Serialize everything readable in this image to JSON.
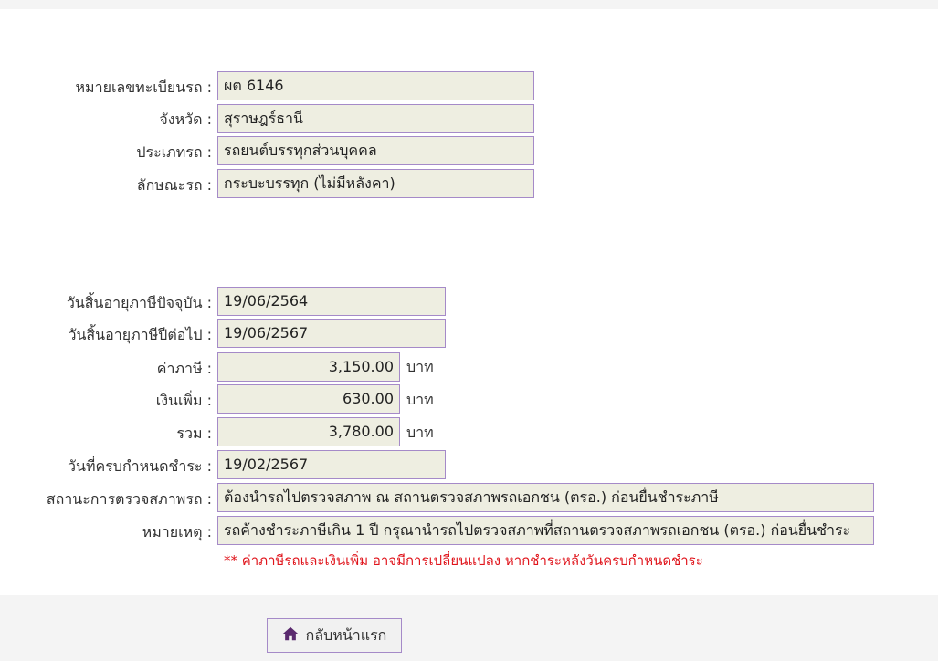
{
  "vehicle": {
    "plate_label": "หมายเลขทะเบียนรถ :",
    "plate_value": "ผต 6146",
    "province_label": "จังหวัด :",
    "province_value": "สุราษฎร์ธานี",
    "type_label": "ประเภทรถ :",
    "type_value": "รถยนต์บรรทุกส่วนบุคคล",
    "body_label": "ลักษณะรถ :",
    "body_value": "กระบะบรรทุก (ไม่มีหลังคา)"
  },
  "tax": {
    "current_expiry_label": "วันสิ้นอายุภาษีปัจจุบัน :",
    "current_expiry_value": "19/06/2564",
    "next_expiry_label": "วันสิ้นอายุภาษีปีต่อไป :",
    "next_expiry_value": "19/06/2567",
    "fee_label": "ค่าภาษี :",
    "fee_value": "3,150.00",
    "surcharge_label": "เงินเพิ่ม :",
    "surcharge_value": "630.00",
    "total_label": "รวม :",
    "total_value": "3,780.00",
    "unit": "บาท",
    "due_label": "วันที่ครบกำหนดชำระ :",
    "due_value": "19/02/2567",
    "inspection_label": "สถานะการตรวจสภาพรถ :",
    "inspection_value": "ต้องนำรถไปตรวจสภาพ ณ สถานตรวจสภาพรถเอกชน (ตรอ.) ก่อนยื่นชำระภาษี",
    "remark_label": "หมายเหตุ :",
    "remark_value": "รถค้างชำระภาษีเกิน 1 ปี กรุณานำรถไปตรวจสภาพที่สถานตรวจสภาพรถเอกชน (ตรอ.) ก่อนยื่นชำระ",
    "warning_note": "** ค่าภาษีรถและเงินเพิ่ม อาจมีการเปลี่ยนแปลง หากชำระหลังวันครบกำหนดชำระ"
  },
  "actions": {
    "home_label": "กลับหน้าแรก",
    "home_icon": "home-icon"
  },
  "colors": {
    "field_bg": "#eeeee1",
    "field_border": "#a58ac8",
    "warning": "#e0151c",
    "icon": "#5a2a6e"
  }
}
